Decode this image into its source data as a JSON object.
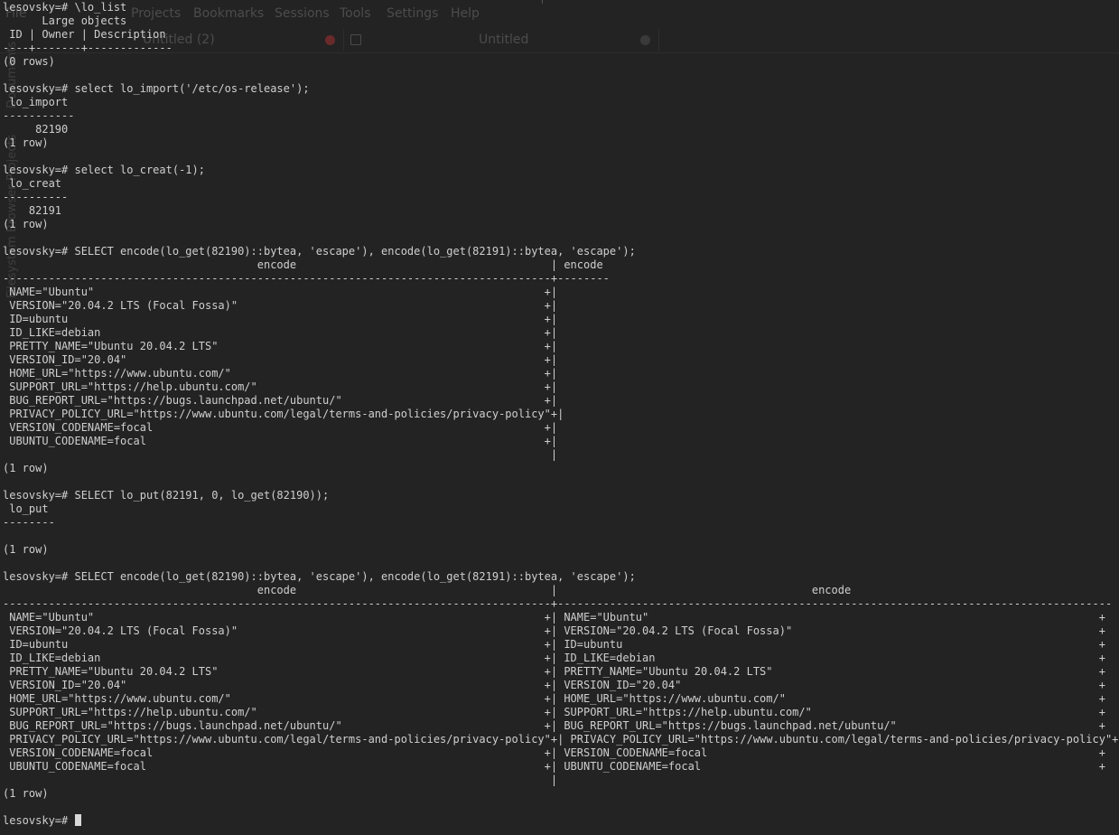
{
  "background_window": {
    "menu": [
      "File",
      "Projects",
      "Bookmarks",
      "Sessions",
      "Tools",
      "Settings",
      "Help"
    ],
    "tabs": [
      {
        "label": "Untitled (2)"
      },
      {
        "label": "Untitled"
      }
    ],
    "side_panels": [
      "Documents",
      "Projects",
      "Filesystem Browser"
    ]
  },
  "colors": {
    "terminal_bg": "#232323",
    "terminal_fg": "#cfcfcf",
    "ghost_text": "#4c4c4c",
    "close_icon": "#6a2a2a"
  },
  "terminal": {
    "lines": [
      "lesovsky=# \\lo_list",
      "      Large objects",
      " ID | Owner | Description",
      "----+-------+-------------",
      "(0 rows)",
      "",
      "lesovsky=# select lo_import('/etc/os-release');",
      " lo_import",
      "-----------",
      "     82190",
      "(1 row)",
      "",
      "lesovsky=# select lo_creat(-1);",
      " lo_creat",
      "----------",
      "    82191",
      "(1 row)",
      "",
      "lesovsky=# SELECT encode(lo_get(82190)::bytea, 'escape'), encode(lo_get(82191)::bytea, 'escape');",
      "                                       encode                                       | encode",
      "------------------------------------------------------------------------------------+--------",
      " NAME=\"Ubuntu\"                                                                     +|",
      " VERSION=\"20.04.2 LTS (Focal Fossa)\"                                               +|",
      " ID=ubuntu                                                                         +|",
      " ID_LIKE=debian                                                                    +|",
      " PRETTY_NAME=\"Ubuntu 20.04.2 LTS\"                                                  +|",
      " VERSION_ID=\"20.04\"                                                                +|",
      " HOME_URL=\"https://www.ubuntu.com/\"                                                +|",
      " SUPPORT_URL=\"https://help.ubuntu.com/\"                                            +|",
      " BUG_REPORT_URL=\"https://bugs.launchpad.net/ubuntu/\"                               +|",
      " PRIVACY_POLICY_URL=\"https://www.ubuntu.com/legal/terms-and-policies/privacy-policy\"+|",
      " VERSION_CODENAME=focal                                                            +|",
      " UBUNTU_CODENAME=focal                                                             +|",
      "                                                                                    |",
      "(1 row)",
      "",
      "lesovsky=# SELECT lo_put(82191, 0, lo_get(82190));",
      " lo_put",
      "--------",
      "",
      "(1 row)",
      "",
      "lesovsky=# SELECT encode(lo_get(82190)::bytea, 'escape'), encode(lo_get(82191)::bytea, 'escape');",
      "                                       encode                                       |                                       encode",
      "------------------------------------------------------------------------------------+-------------------------------------------------------------------------------------",
      " NAME=\"Ubuntu\"                                                                     +| NAME=\"Ubuntu\"                                                                     +",
      " VERSION=\"20.04.2 LTS (Focal Fossa)\"                                               +| VERSION=\"20.04.2 LTS (Focal Fossa)\"                                               +",
      " ID=ubuntu                                                                         +| ID=ubuntu                                                                         +",
      " ID_LIKE=debian                                                                    +| ID_LIKE=debian                                                                    +",
      " PRETTY_NAME=\"Ubuntu 20.04.2 LTS\"                                                  +| PRETTY_NAME=\"Ubuntu 20.04.2 LTS\"                                                  +",
      " VERSION_ID=\"20.04\"                                                                +| VERSION_ID=\"20.04\"                                                                +",
      " HOME_URL=\"https://www.ubuntu.com/\"                                                +| HOME_URL=\"https://www.ubuntu.com/\"                                                +",
      " SUPPORT_URL=\"https://help.ubuntu.com/\"                                            +| SUPPORT_URL=\"https://help.ubuntu.com/\"                                            +",
      " BUG_REPORT_URL=\"https://bugs.launchpad.net/ubuntu/\"                               +| BUG_REPORT_URL=\"https://bugs.launchpad.net/ubuntu/\"                               +",
      " PRIVACY_POLICY_URL=\"https://www.ubuntu.com/legal/terms-and-policies/privacy-policy\"+| PRIVACY_POLICY_URL=\"https://www.ubuntu.com/legal/terms-and-policies/privacy-policy\"+",
      " VERSION_CODENAME=focal                                                            +| VERSION_CODENAME=focal                                                            +",
      " UBUNTU_CODENAME=focal                                                             +| UBUNTU_CODENAME=focal                                                             +",
      "                                                                                    |",
      "(1 row)",
      ""
    ],
    "prompt": "lesovsky=# "
  }
}
